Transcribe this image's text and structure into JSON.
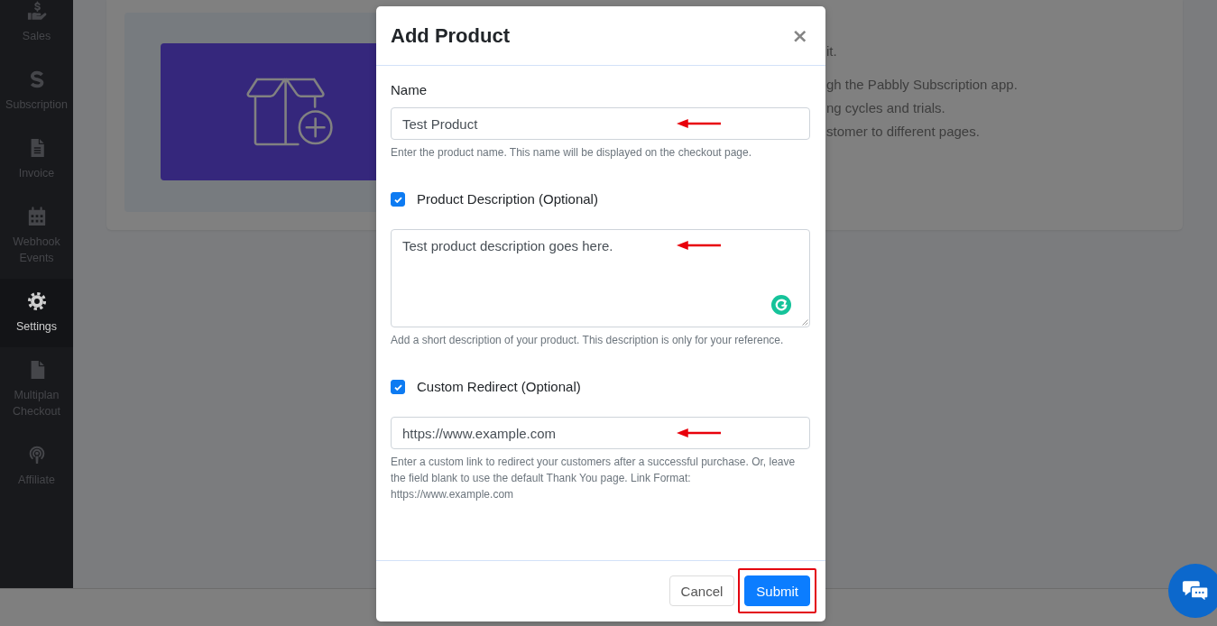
{
  "sidebar": {
    "items": [
      {
        "label": "Sales",
        "selected": false
      },
      {
        "label": "Subscription",
        "selected": false
      },
      {
        "label": "Invoice",
        "selected": false
      },
      {
        "label": "Webhook Events",
        "selected": false
      },
      {
        "label": "Settings",
        "selected": true
      },
      {
        "label": "Multiplan Checkout",
        "selected": false
      },
      {
        "label": "Affiliate",
        "selected": false
      }
    ]
  },
  "background_card": {
    "paragraph": "it.",
    "points": [
      "gh the Pabbly Subscription app.",
      "ng cycles and trials.",
      "stomer to different pages."
    ]
  },
  "modal": {
    "title": "Add Product",
    "close": "×",
    "name_field": {
      "label": "Name",
      "value": "Test Product",
      "help": "Enter the product name. This name will be displayed on the checkout page.",
      "marked": true
    },
    "optional_fields": [
      {
        "kind": "textarea",
        "label": "Product Description (Optional)",
        "checked": true,
        "value": "Test product description goes here.",
        "help": "Add a short description of your product. This description is only for your reference.",
        "marked": true
      },
      {
        "kind": "input",
        "label": "Custom Redirect (Optional)",
        "checked": true,
        "value": "https://www.example.com",
        "help": "Enter a custom link to redirect your customers after a successful purchase. Or, leave the field blank to use the default Thank You page. Link Format: https://www.example.com",
        "marked": true
      }
    ],
    "buttons": [
      {
        "label": "Cancel",
        "kind": "secondary",
        "highlighted": false
      },
      {
        "label": "Submit",
        "kind": "primary",
        "highlighted": true
      }
    ]
  }
}
